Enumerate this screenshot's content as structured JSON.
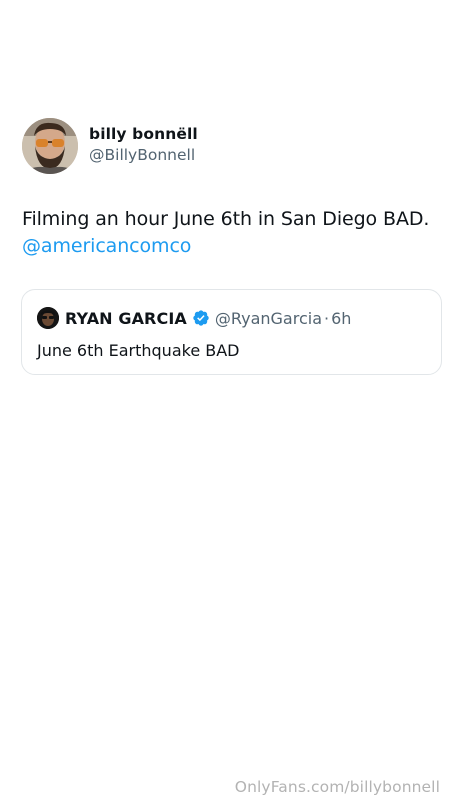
{
  "tweet": {
    "author": {
      "display_name": "billy bonnëll",
      "handle": "@BillyBonnell",
      "avatar_icon": "bearded-man-sunglasses-avatar"
    },
    "text": "Filming an hour June 6th in San Diego BAD.",
    "mention": "@americancomco",
    "quote": {
      "display_name": "RYAN GARCIA",
      "verified_icon": "verified-badge-icon",
      "verified_color": "#1d9bf0",
      "handle": "@RyanGarcia",
      "separator": "·",
      "time": "6h",
      "text": "June 6th Earthquake BAD"
    }
  },
  "watermark": "OnlyFans.com/billybonnell",
  "colors": {
    "text": "#0f1419",
    "secondary": "#536471",
    "link": "#1d9bf0",
    "border": "#e2e6e9",
    "watermark": "#b3b3b3"
  }
}
